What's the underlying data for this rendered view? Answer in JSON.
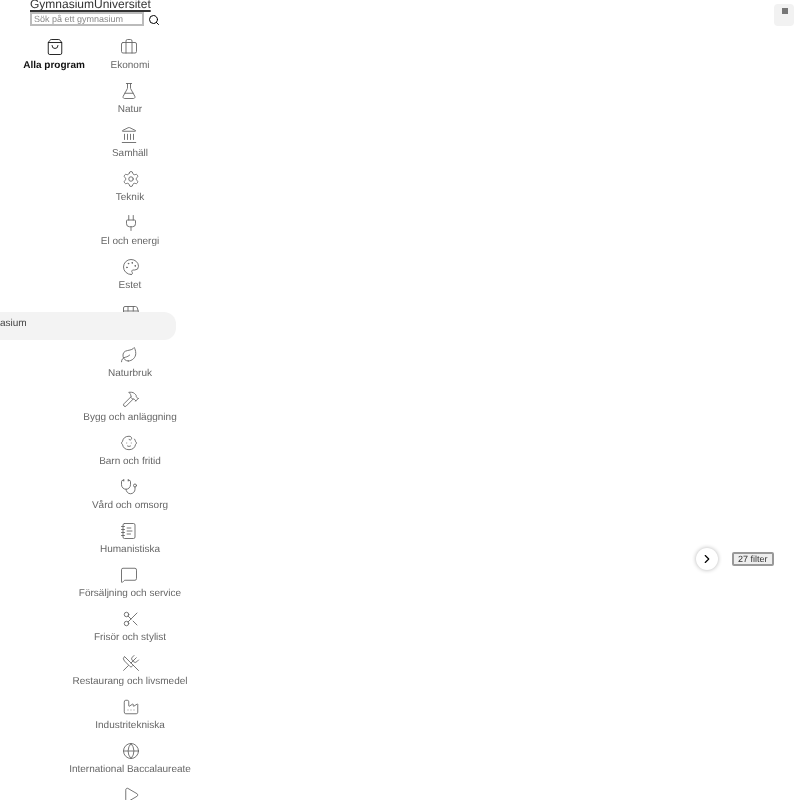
{
  "header": {
    "links": [
      "Gymnasium",
      "Universitet"
    ],
    "search": {
      "placeholder": "Sök på ett gymnasium"
    }
  },
  "tabs": [
    {
      "label": "Alla program",
      "selected": true
    },
    {
      "label": "Ekonomi",
      "selected": false
    },
    {
      "label": "Natur",
      "selected": false
    },
    {
      "label": "Samhäll",
      "selected": false
    },
    {
      "label": "Teknik",
      "selected": false
    },
    {
      "label": "El och energi",
      "selected": false
    },
    {
      "label": "Estet",
      "selected": false
    },
    {
      "selected": false
    },
    {
      "label": "Naturbruk",
      "selected": false
    },
    {
      "label": "Bygg och anläggning",
      "selected": false
    },
    {
      "label": "Barn och fritid",
      "selected": false
    },
    {
      "label": "Vård och omsorg",
      "selected": false
    },
    {
      "label": "Humanistiska",
      "selected": false
    },
    {
      "label": "Försäljning och service",
      "selected": false
    },
    {
      "label": "Frisör och stylist",
      "selected": false
    },
    {
      "label": "Restaurang och livsmedel",
      "selected": false
    },
    {
      "label": "Industritekniska",
      "selected": false
    },
    {
      "label": "International Baccalaureate",
      "selected": false
    },
    {
      "selected": false
    }
  ],
  "suggestion": {
    "text": "asium"
  },
  "filter_badge": {
    "text": "27 filter"
  }
}
